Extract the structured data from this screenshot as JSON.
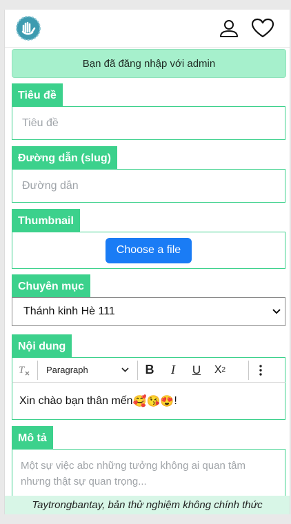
{
  "header": {
    "logo_icon": "hand-heart-logo",
    "user_icon": "user-icon",
    "favorites_icon": "heart-icon"
  },
  "alert": {
    "text": "Bạn đã đăng nhập với admin"
  },
  "form": {
    "title": {
      "label": "Tiêu đề",
      "placeholder": "Tiêu đề"
    },
    "slug": {
      "label": "Đường dẫn (slug)",
      "placeholder": "Đường dẫn"
    },
    "thumbnail": {
      "label": "Thumbnail",
      "button": "Choose a file"
    },
    "category": {
      "label": "Chuyên mục",
      "selected": "Thánh kinh Hè 111"
    },
    "content": {
      "label": "Nội dung",
      "toolbar": {
        "paragraph_format": "Paragraph"
      },
      "text": "Xin chào bạn thân mến",
      "emojis": "🥰😘😍",
      "suffix": "!"
    },
    "description": {
      "label": "Mô tả",
      "placeholder": "Một sự việc abc những tưởng không ai quan tâm nhưng thật sự quan trọng..."
    }
  },
  "footer": {
    "text": "Taytrongbantay, bản thử nghiệm không chính thức"
  },
  "colors": {
    "accent": "#3cd18c",
    "alert_bg": "#a6f0cc",
    "button": "#1a7cf5",
    "logo": "#3d9bb0"
  }
}
